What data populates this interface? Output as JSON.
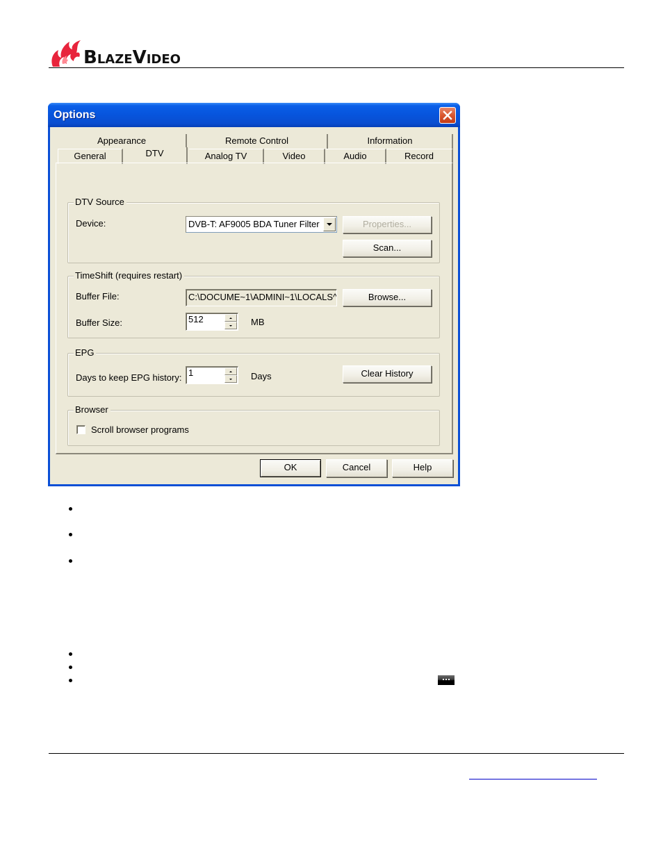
{
  "header": {
    "logo_text": "BlazeVideo",
    "logo_icon": "flame-icon",
    "brand_color": "#e8243c"
  },
  "dialog": {
    "title": "Options",
    "close_icon": "close-icon",
    "tabs_row1": [
      {
        "label": "Appearance"
      },
      {
        "label": "Remote Control"
      },
      {
        "label": "Information"
      }
    ],
    "tabs_row2": [
      {
        "label": "General"
      },
      {
        "label": "DTV",
        "active": true
      },
      {
        "label": "Analog TV"
      },
      {
        "label": "Video"
      },
      {
        "label": "Audio"
      },
      {
        "label": "Record"
      }
    ],
    "dtv_source": {
      "legend": "DTV Source",
      "device_label": "Device:",
      "device_value": "DVB-T: AF9005 BDA Tuner Filter",
      "properties_button": "Properties...",
      "scan_button": "Scan..."
    },
    "timeshift": {
      "legend": "TimeShift (requires restart)",
      "buffer_file_label": "Buffer File:",
      "buffer_file_value": "C:\\DOCUME~1\\ADMINI~1\\LOCALS^",
      "browse_button": "Browse...",
      "buffer_size_label": "Buffer Size:",
      "buffer_size_value": "512",
      "buffer_size_unit": "MB"
    },
    "epg": {
      "legend": "EPG",
      "days_label": "Days to keep EPG history:",
      "days_value": "1",
      "days_unit": "Days",
      "clear_history_button": "Clear History"
    },
    "browser": {
      "legend": "Browser",
      "scroll_label": "Scroll browser programs",
      "scroll_checked": false
    },
    "footer_buttons": {
      "ok": "OK",
      "cancel": "Cancel",
      "help": "Help"
    }
  },
  "bullets": {
    "group1_count": 3,
    "group2_count": 3,
    "inline_icon": "ellipsis-button-icon"
  },
  "footer": {
    "link_text": ""
  }
}
